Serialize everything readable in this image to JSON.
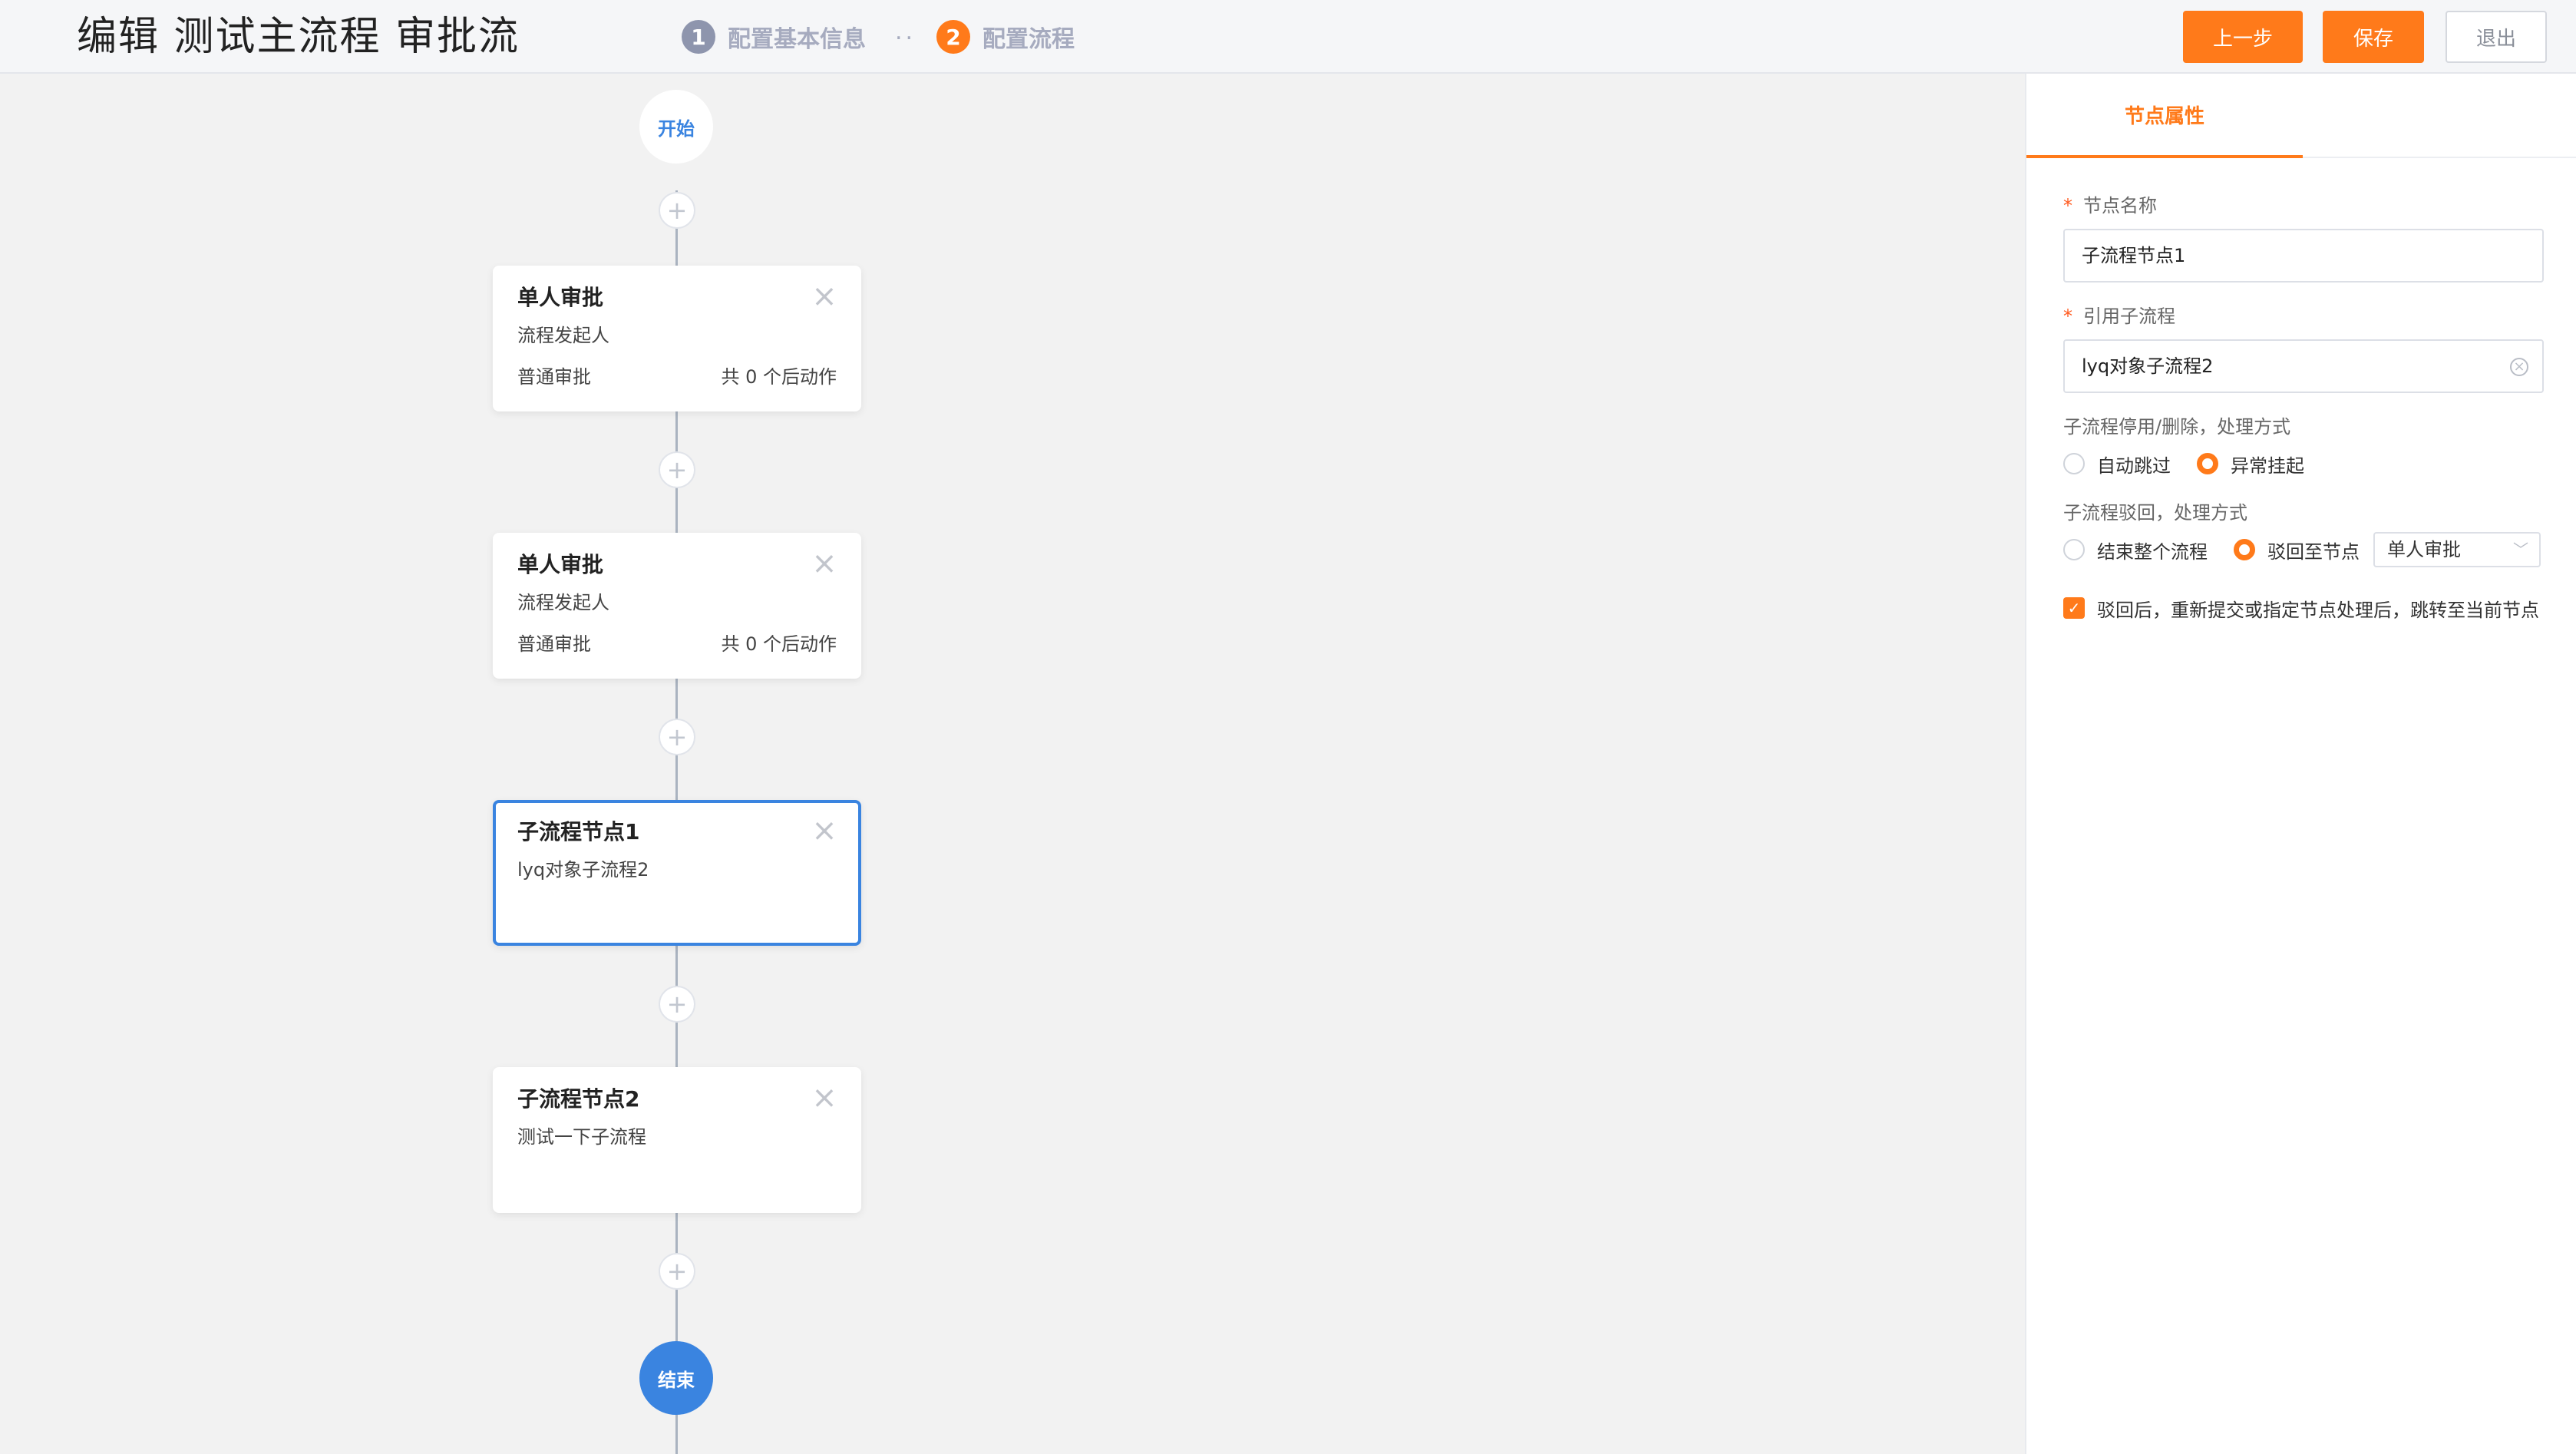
{
  "header": {
    "title": "编辑 测试主流程 审批流",
    "steps": [
      {
        "num": "1",
        "label": "配置基本信息",
        "color": "#8e95ad"
      },
      {
        "num": "2",
        "label": "配置流程",
        "color": "#ff7a1a"
      }
    ],
    "step_separator": "..",
    "buttons": {
      "prev": "上一步",
      "save": "保存",
      "exit": "退出"
    }
  },
  "flow": {
    "start_label": "开始",
    "end_label": "结束",
    "add_symbol": "+",
    "close_symbol": "×",
    "nodes": [
      {
        "title": "单人审批",
        "subtitle": "流程发起人",
        "type": "普通审批",
        "actions": "共 0 个后动作"
      },
      {
        "title": "单人审批",
        "subtitle": "流程发起人",
        "type": "普通审批",
        "actions": "共 0 个后动作"
      },
      {
        "title": "子流程节点1",
        "subtitle": "lyq对象子流程2",
        "selected": true
      },
      {
        "title": "子流程节点2",
        "subtitle": "测试一下子流程"
      }
    ]
  },
  "panel": {
    "tab": "节点属性",
    "required_mark": "*",
    "node_name_label": "节点名称",
    "node_name_value": "子流程节点1",
    "subprocess_label": "引用子流程",
    "subprocess_value": "lyq对象子流程2",
    "disable_label": "子流程停用/删除，处理方式",
    "disable_options": [
      "自动跳过",
      "异常挂起"
    ],
    "disable_selected": "异常挂起",
    "reject_label": "子流程驳回，处理方式",
    "reject_options": [
      "结束整个流程",
      "驳回至节点"
    ],
    "reject_selected": "驳回至节点",
    "reject_node_select": "单人审批",
    "jump_checkbox_label": "驳回后，重新提交或指定节点处理后，跳转至当前节点",
    "jump_checked": true,
    "accent_color": "#ff7a1a"
  }
}
